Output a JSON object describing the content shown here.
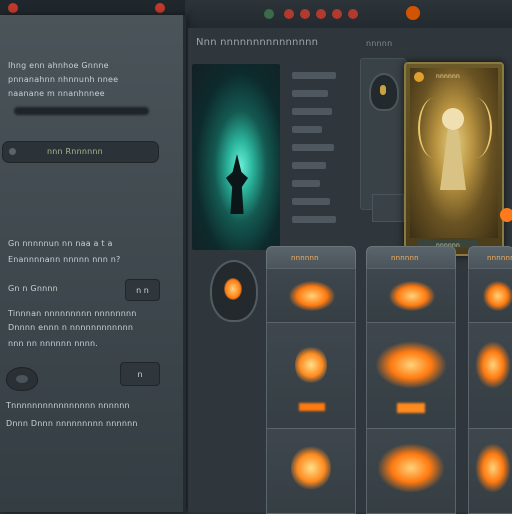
{
  "topbar": {
    "dots": [
      "#3a6b4a",
      "#c0392b",
      "#c0392b",
      "#c0392b",
      "#c0392b",
      "#c0392b",
      "#d35400"
    ]
  },
  "left_panel": {
    "intro_lines": [
      "Ihng enn ahnhoe Gnnne",
      "pnnanahnn nhnnunh nnee",
      "naanane m nnanhnnee"
    ],
    "section_pill": "nnn  Rnnnnnn",
    "para_lines": [
      "Gn nnnnnun nn naa a t a",
      "Enannnnann nnnnn nnn n?"
    ],
    "toggle_label": "Gn n  Gnnnn",
    "toggle_value": "n n",
    "desc_lines": [
      "Tinnnan nnnnnnnnn nnnnnnnn",
      "Dnnnn ennn n nnnnnnnnnnnn",
      "nnn nn nnnnnn nnnn."
    ],
    "option_value": "n",
    "footer_lines": [
      "Tnnnnnnnnnnnnnnnn nnnnnn",
      "Dnnn Dnnn nnnnnnnnn nnnnnn"
    ]
  },
  "main": {
    "title": "Nnn nnnnnnnnnnnnnnn",
    "subtitle": "nnnnn",
    "stats_count": 9,
    "card_title": "nnnnnn",
    "card_footer": "nnnnnn",
    "slots": [
      "nnnnnn",
      "nnnnnn",
      "nnnnnn"
    ],
    "colors": {
      "glow": "#3fe0c8",
      "fire": "#ff8a1e",
      "gold": "#c9a340"
    }
  }
}
